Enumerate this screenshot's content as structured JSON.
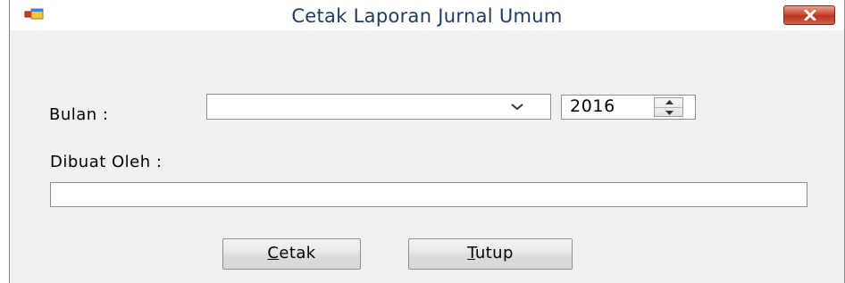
{
  "window": {
    "title": "Cetak Laporan Jurnal Umum"
  },
  "form": {
    "bulan_label": "Bulan :",
    "month_selected": "",
    "year_value": "2016",
    "dibuat_label": "Dibuat Oleh :",
    "dibuat_value": ""
  },
  "buttons": {
    "cetak_label": "Cetak",
    "tutup_label": "Tutup"
  },
  "icons": {
    "app": "app-window-icon",
    "close": "close-icon",
    "dropdown": "chevron-down-icon",
    "spin_up": "spin-up-arrow-icon",
    "spin_down": "spin-down-arrow-icon"
  },
  "colors": {
    "title_text": "#1e3a5c",
    "close_button": "#c9452c",
    "window_background": "#f0f0f0"
  }
}
